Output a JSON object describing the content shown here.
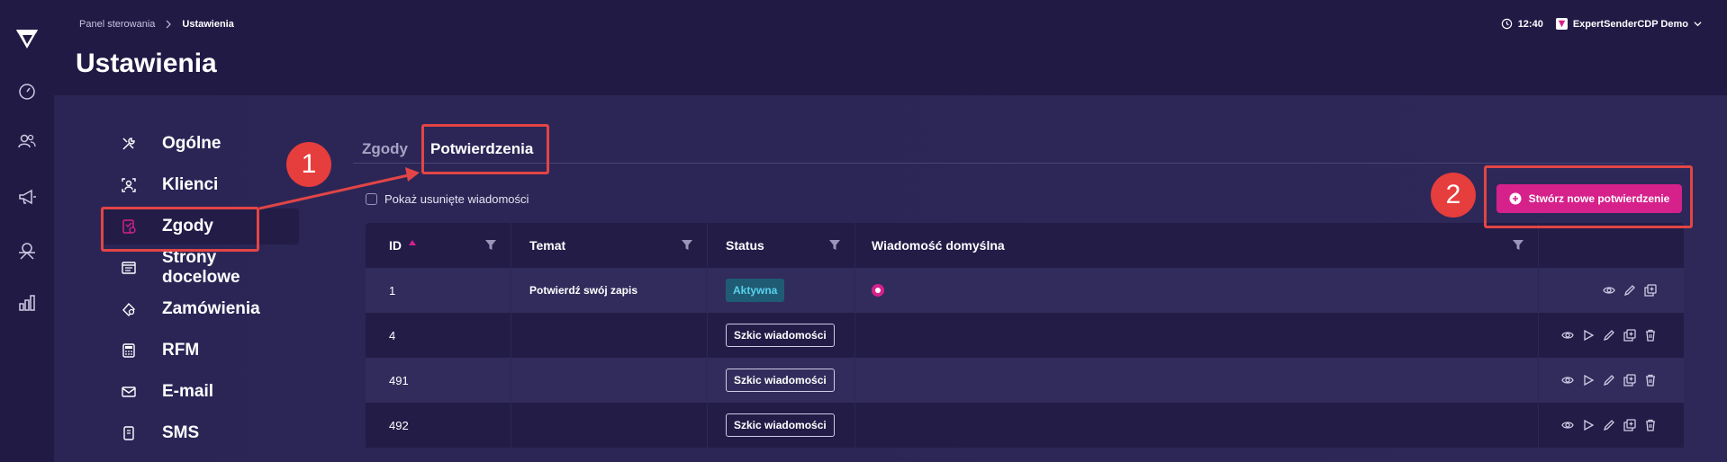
{
  "breadcrumb": {
    "parent": "Panel sterowania",
    "current": "Ustawienia"
  },
  "page": {
    "title": "Ustawienia"
  },
  "topbar": {
    "time": "12:40",
    "account": "ExpertSenderCDP Demo"
  },
  "menu": {
    "items": [
      {
        "label": "Ogólne",
        "icon": "tools-icon"
      },
      {
        "label": "Klienci",
        "icon": "customer-icon"
      },
      {
        "label": "Zgody",
        "icon": "consent-icon",
        "active": true
      },
      {
        "label": "Strony docelowe",
        "icon": "landing-page-icon"
      },
      {
        "label": "Zamówienia",
        "icon": "orders-icon"
      },
      {
        "label": "RFM",
        "icon": "calculator-icon"
      },
      {
        "label": "E-mail",
        "icon": "mail-icon"
      },
      {
        "label": "SMS",
        "icon": "sms-icon"
      }
    ]
  },
  "tabs": [
    {
      "label": "Zgody",
      "active": false
    },
    {
      "label": "Potwierdzenia",
      "active": true
    }
  ],
  "filter": {
    "show_deleted_label": "Pokaż usunięte wiadomości"
  },
  "create_button": {
    "label": "Stwórz nowe potwierdzenie"
  },
  "table": {
    "headers": {
      "id": "ID",
      "subject": "Temat",
      "status": "Status",
      "default_message": "Wiadomość domyślna"
    },
    "rows": [
      {
        "id": "1",
        "subject": "Potwierdź swój zapis",
        "status": "Aktywna",
        "default": true
      },
      {
        "id": "4",
        "subject": "",
        "status": "Szkic wiadomości",
        "default": false
      },
      {
        "id": "491",
        "subject": "",
        "status": "Szkic wiadomości",
        "default": false
      },
      {
        "id": "492",
        "subject": "",
        "status": "Szkic wiadomości",
        "default": false
      }
    ]
  },
  "annotations": {
    "first": "1",
    "second": "2"
  },
  "colors": {
    "background": "#201a44",
    "panel": "#2b2556",
    "accent": "#d6218b",
    "annotation": "#e24545",
    "badge_active_text": "#5ad0ee"
  }
}
